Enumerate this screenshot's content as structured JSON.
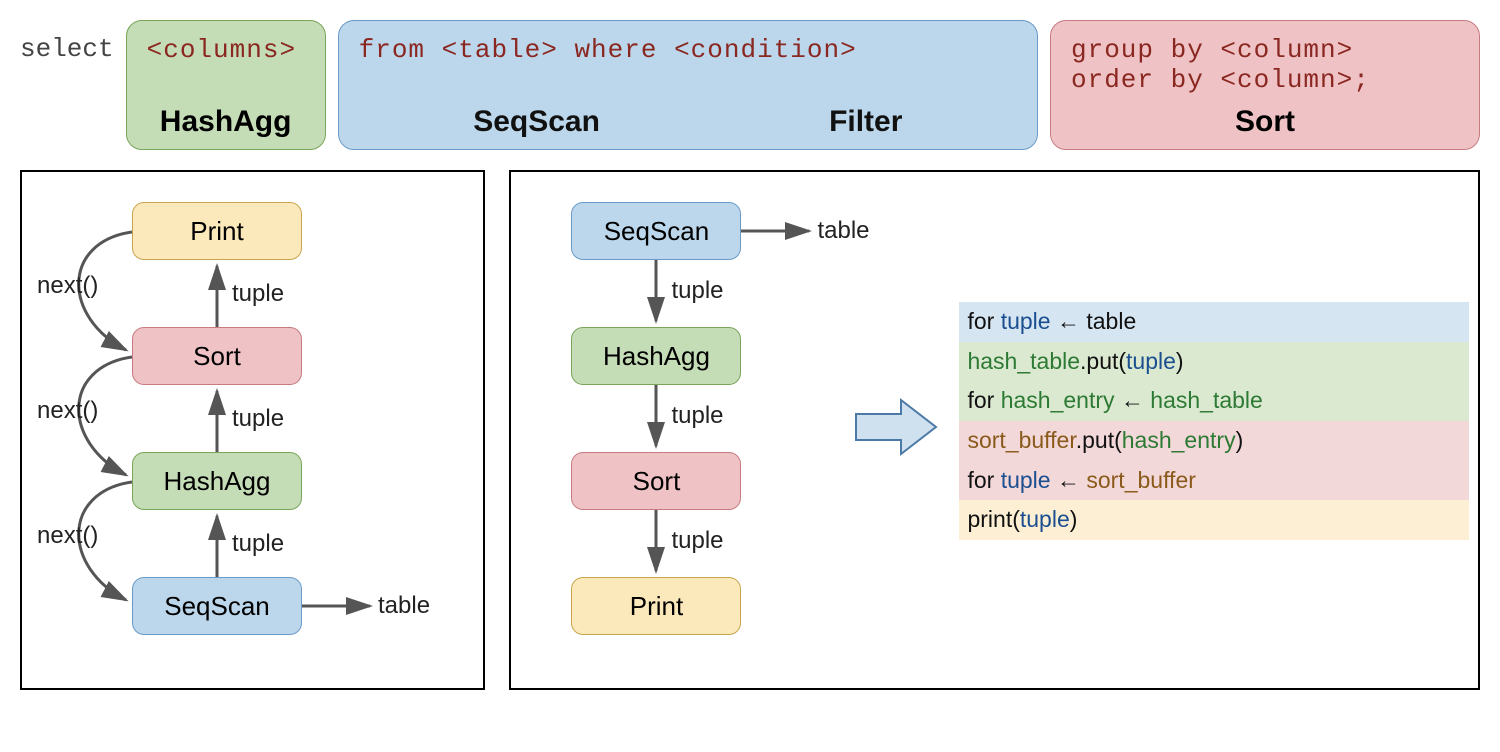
{
  "top": {
    "select_keyword": "select",
    "hashagg": {
      "clause": "<columns>",
      "label": "HashAgg"
    },
    "scan": {
      "clause": "from <table> where <condition>",
      "label_left": "SeqScan",
      "label_right": "Filter"
    },
    "sort": {
      "clause1": "group by <column>",
      "clause2": "order by <column>;",
      "label": "Sort"
    }
  },
  "left_panel": {
    "nodes": {
      "print": "Print",
      "sort": "Sort",
      "hashagg": "HashAgg",
      "seqscan": "SeqScan"
    },
    "edge_labels": {
      "next": "next()",
      "tuple": "tuple",
      "table": "table"
    }
  },
  "right_panel": {
    "nodes": {
      "seqscan": "SeqScan",
      "hashagg": "HashAgg",
      "sort": "Sort",
      "print": "Print"
    },
    "edge_labels": {
      "tuple": "tuple",
      "table": "table"
    },
    "pseudocode": {
      "l1_for": "for ",
      "l1_tuple": "tuple",
      "l1_arrow": " ← ",
      "l1_table": "table",
      "l2_hash_table": "hash_table",
      "l2_put": ".put(",
      "l2_tuple": "tuple",
      "l2_close": ")",
      "l3_for": "for ",
      "l3_hash_entry": "hash_entry",
      "l3_arrow": " ← ",
      "l3_hash_table": "hash_table",
      "l4_sort_buffer": "sort_buffer",
      "l4_put": ".put(",
      "l4_hash_entry": "hash_entry",
      "l4_close": ")",
      "l5_for": "for ",
      "l5_tuple": "tuple",
      "l5_arrow": " ← ",
      "l5_sort_buffer": "sort_buffer",
      "l6_print": "print(",
      "l6_tuple": "tuple",
      "l6_close": ")"
    }
  }
}
